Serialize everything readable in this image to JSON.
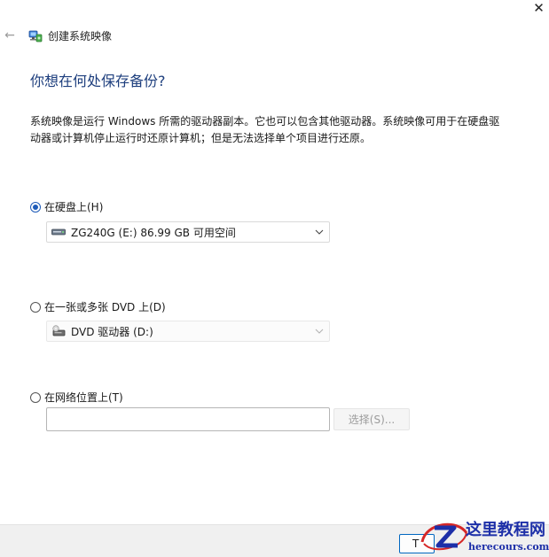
{
  "window": {
    "title": "创建系统映像",
    "close_symbol": "✕",
    "back_symbol": "←"
  },
  "heading": "你想在何处保存备份?",
  "description": "系统映像是运行 Windows 所需的驱动器副本。它也可以包含其他驱动器。系统映像可用于在硬盘驱动器或计算机停止运行时还原计算机；但是无法选择单个项目进行还原。",
  "options": {
    "hard_disk": {
      "label": "在硬盘上(H)",
      "checked": true,
      "selected_drive": "ZG240G (E:)  86.99 GB 可用空间"
    },
    "dvd": {
      "label": "在一张或多张 DVD 上(D)",
      "checked": false,
      "selected_drive": "DVD 驱动器 (D:)"
    },
    "network": {
      "label": "在网络位置上(T)",
      "checked": false,
      "path_value": "",
      "browse_label": "选择(S)..."
    }
  },
  "footer": {
    "next_label": "T"
  },
  "watermark": {
    "title": "这里教程网",
    "url": "herecours.com"
  },
  "colors": {
    "heading": "#1d3e7d",
    "accent": "#1e5bb8",
    "watermark": "#1d2fa8"
  },
  "icons": {
    "app": "system-image-backup-icon",
    "hard_drive": "hard-drive-icon",
    "dvd_drive": "dvd-drive-icon"
  }
}
